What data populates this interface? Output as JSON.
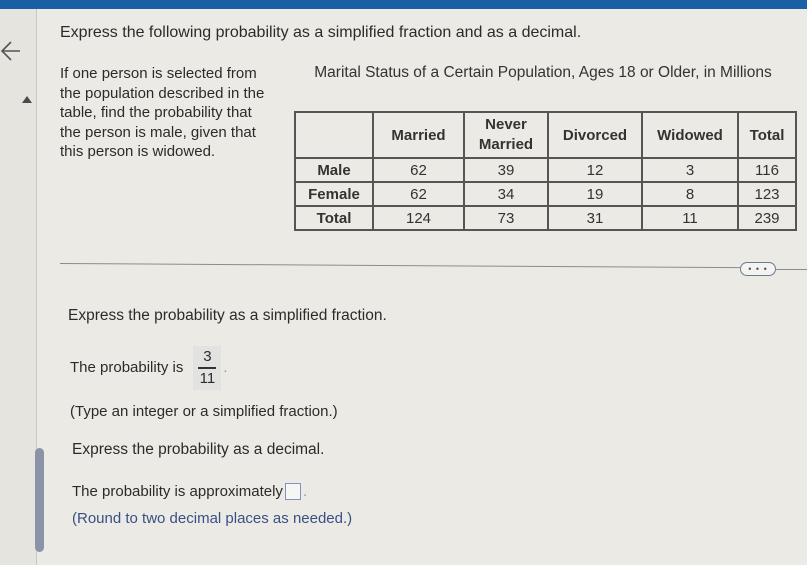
{
  "header": {
    "accent_color": "#1a5fa6",
    "title": "Express the following probability as a simplified fraction and as a decimal."
  },
  "nav": {
    "back_icon": "arrow-left-icon",
    "scroll_up_icon": "triangle-up-icon"
  },
  "problem": {
    "prompt": "If one person is selected from the population described in the table, find the probability that the person is male, given that this person is widowed."
  },
  "table": {
    "caption": "Marital Status of a Certain Population, Ages 18 or Older, in Millions",
    "columns": [
      "",
      "Married",
      "Never Married",
      "Divorced",
      "Widowed",
      "Total"
    ],
    "rows": [
      {
        "label": "Male",
        "values": [
          "62",
          "39",
          "12",
          "3",
          "116"
        ]
      },
      {
        "label": "Female",
        "values": [
          "62",
          "34",
          "19",
          "8",
          "123"
        ]
      },
      {
        "label": "Total",
        "values": [
          "124",
          "73",
          "31",
          "11",
          "239"
        ]
      }
    ]
  },
  "more_button": {
    "label": "• • •"
  },
  "part1": {
    "title": "Express the probability as a simplified fraction.",
    "answer_prefix": "The probability is",
    "answer_numerator": "3",
    "answer_denominator": "11",
    "period": ".",
    "hint": "(Type an integer or a simplified fraction.)"
  },
  "part2": {
    "title": "Express the probability as a decimal.",
    "answer_prefix": "The probability is approximately",
    "answer_value": "",
    "period": ".",
    "hint": "(Round to two decimal places as needed.)"
  }
}
